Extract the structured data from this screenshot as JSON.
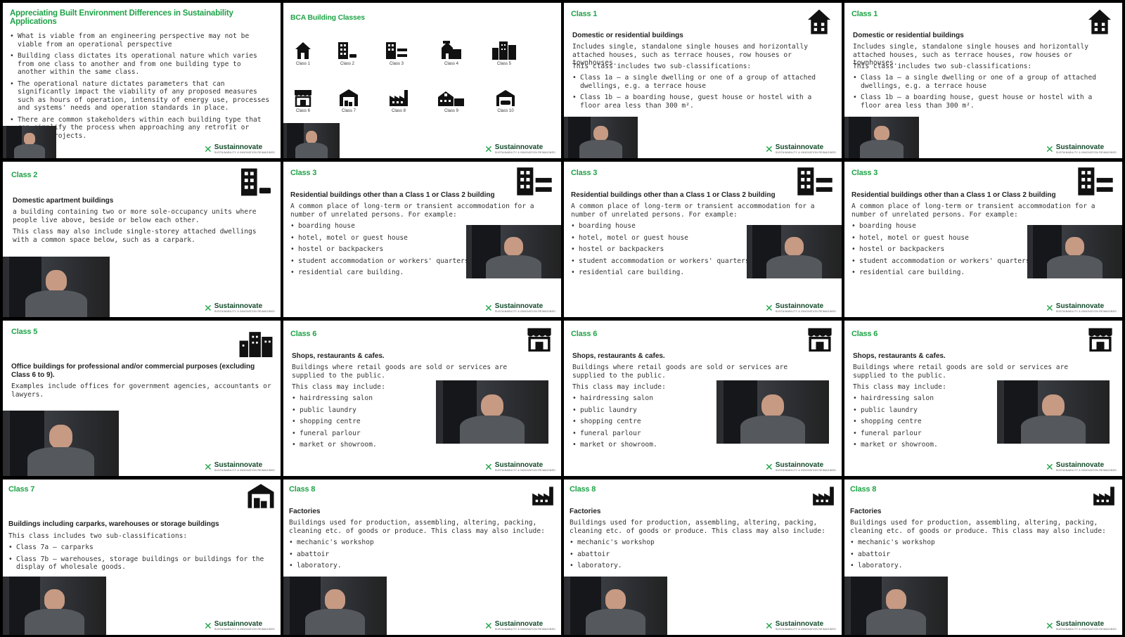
{
  "brand": {
    "name": "Sustainnovate",
    "tagline": "SUSTAINABILITY & INNOVATION REIMAGINED",
    "accent": "#1fa347"
  },
  "slides": [
    {
      "title": "Appreciating Built Environment Differences in Sustainability Applications",
      "bullets": [
        "What is viable from an engineering perspective may not be viable from an operational perspective",
        "Building class dictates its operational nature which varies from one class to another and from one building type to another within the same class.",
        "The operational nature dictates parameters that can significantly impact the viability of any proposed measures such as hours of operation, intensity of energy use, processes and systems' needs and operation standards in place.",
        "There are common stakeholders within each building type that can simplify the process when approaching any retrofit or upgrade projects."
      ]
    },
    {
      "title": "BCA Building Classes",
      "classes": [
        {
          "label": "Class 1",
          "icon": "house-icon"
        },
        {
          "label": "Class 2",
          "icon": "apartment-car-icon"
        },
        {
          "label": "Class 3",
          "icon": "building-beds-icon"
        },
        {
          "label": "Class 4",
          "icon": "mixed-building-icon"
        },
        {
          "label": "Class 5",
          "icon": "office-buildings-icon"
        },
        {
          "label": "Class 6",
          "icon": "shop-icon"
        },
        {
          "label": "Class 7",
          "icon": "warehouse-icon"
        },
        {
          "label": "Class 8",
          "icon": "factory-icon"
        },
        {
          "label": "Class 9",
          "icon": "hospital-icon"
        },
        {
          "label": "Class 10",
          "icon": "carport-icon"
        }
      ]
    },
    {
      "title": "Class 1",
      "heading": "Domestic or residential buildings",
      "intro": "Includes single, standalone single houses and horizontally attached houses, such as terrace houses, row houses or townhouses.",
      "intro2": "This class includes two sub-classifications:",
      "bullets": [
        "Class 1a – a single dwelling or one of a group of attached dwellings, e.g. a terrace house",
        "Class 1b – a boarding house, guest house or hostel with a floor area less than 300 m²."
      ]
    },
    {
      "title": "Class 1",
      "heading": "Domestic or residential buildings",
      "intro": "Includes single, standalone single houses and horizontally attached houses, such as terrace houses, row houses or townhouses.",
      "intro2": "This class includes two sub-classifications:",
      "bullets": [
        "Class 1a – a single dwelling or one of a group of attached dwellings, e.g. a terrace house",
        "Class 1b – a boarding house, guest house or hostel with a floor area less than 300 m²."
      ]
    },
    {
      "title": "Class 2",
      "heading": "Domestic apartment buildings",
      "intro": "a building containing two or more sole-occupancy units where people live above, beside or below each other.",
      "intro2": "This class may also include single-storey attached dwellings with a common space below, such as a carpark."
    },
    {
      "title": "Class 3",
      "heading": "Residential buildings other than a Class 1 or Class 2 building",
      "intro": "A common place of long-term or transient accommodation for a number of unrelated persons. For example:",
      "bullets": [
        "boarding house",
        "hotel, motel or guest house",
        "hostel or backpackers",
        "student accommodation or workers' quarters",
        "residential care building."
      ]
    },
    {
      "title": "Class 3",
      "heading": "Residential buildings other than a Class 1 or Class 2 building",
      "intro": "A common place of long-term or transient accommodation for a number of unrelated persons. For example:",
      "bullets": [
        "boarding house",
        "hotel, motel or guest house",
        "hostel or backpackers",
        "student accommodation or workers' quarters",
        "residential care building."
      ]
    },
    {
      "title": "Class 3",
      "heading": "Residential buildings other than a Class 1 or Class 2 building",
      "intro": "A common place of long-term or transient accommodation for a number of unrelated persons. For example:",
      "bullets": [
        "boarding house",
        "hotel, motel or guest house",
        "hostel or backpackers",
        "student accommodation or workers' quarters",
        "residential care building."
      ]
    },
    {
      "title": "Class 5",
      "heading": "Office buildings for professional and/or commercial purposes (excluding Class 6 to 9).",
      "intro": "Examples include offices for government agencies, accountants or lawyers."
    },
    {
      "title": "Class 6",
      "heading": "Shops, restaurants & cafes.",
      "intro": "Buildings where retail goods are sold or services are supplied to the public.",
      "intro2": "This class may include:",
      "bullets": [
        "hairdressing salon",
        "public laundry",
        "shopping centre",
        "funeral parlour",
        "market or showroom."
      ]
    },
    {
      "title": "Class 6",
      "heading": "Shops, restaurants & cafes.",
      "intro": "Buildings where retail goods are sold or services are supplied to the public.",
      "intro2": "This class may include:",
      "bullets": [
        "hairdressing salon",
        "public laundry",
        "shopping centre",
        "funeral parlour",
        "market or showroom."
      ]
    },
    {
      "title": "Class 6",
      "heading": "Shops, restaurants & cafes.",
      "intro": "Buildings where retail goods are sold or services are supplied to the public.",
      "intro2": "This class may include:",
      "bullets": [
        "hairdressing salon",
        "public laundry",
        "shopping centre",
        "funeral parlour",
        "market or showroom."
      ]
    },
    {
      "title": "Class 7",
      "heading": "Buildings including carparks, warehouses or storage buildings",
      "intro": "This class includes two sub-classifications:",
      "bullets": [
        "Class 7a – carparks",
        "Class 7b – warehouses, storage buildings or buildings for the display of wholesale goods."
      ]
    },
    {
      "title": "Class 8",
      "heading": "Factories",
      "intro": "Buildings used for production, assembling, altering, packing, cleaning etc. of goods or produce. This class may also include:",
      "bullets": [
        "mechanic's workshop",
        "abattoir",
        "laboratory."
      ]
    },
    {
      "title": "Class 8",
      "heading": "Factories",
      "intro": "Buildings used for production, assembling, altering, packing, cleaning etc. of goods or produce. This class may also include:",
      "bullets": [
        "mechanic's workshop",
        "abattoir",
        "laboratory."
      ]
    },
    {
      "title": "Class 8",
      "heading": "Factories",
      "intro": "Buildings used for production, assembling, altering, packing, cleaning etc. of goods or produce. This class may also include:",
      "bullets": [
        "mechanic's workshop",
        "abattoir",
        "laboratory."
      ]
    }
  ]
}
